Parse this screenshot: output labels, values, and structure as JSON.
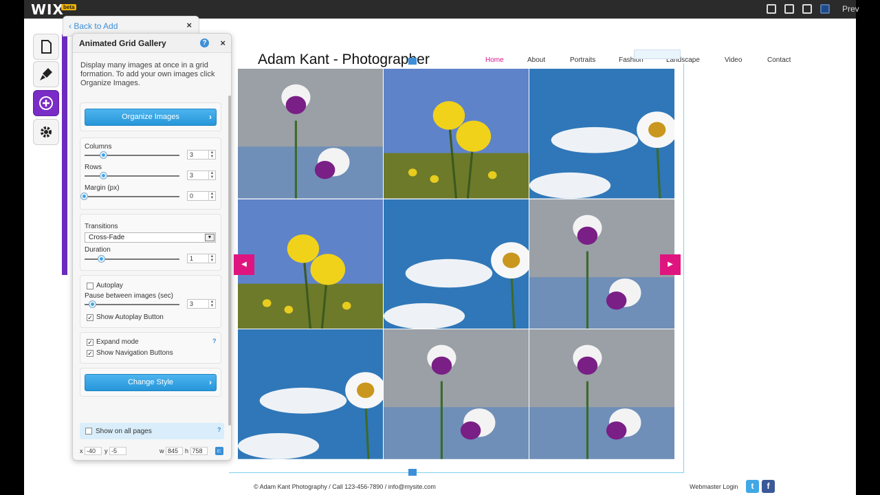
{
  "topbar": {
    "logo": "WIX",
    "beta": "beta",
    "preview": "Prev"
  },
  "back_panel": {
    "link": "Back to Add",
    "close": "×"
  },
  "panel": {
    "title": "Animated Grid Gallery",
    "help": "?",
    "close": "×",
    "description": "Display many images at once in a grid formation. To add your own images click Organize Images.",
    "organize_button": "Organize Images",
    "columns_label": "Columns",
    "columns_value": "3",
    "rows_label": "Rows",
    "rows_value": "3",
    "margin_label": "Margin (px)",
    "margin_value": "0",
    "transitions_label": "Transitions",
    "transition_value": "Cross-Fade",
    "duration_label": "Duration",
    "duration_value": "1",
    "autoplay_label": "Autoplay",
    "pause_label": "Pause between images (sec)",
    "pause_value": "3",
    "show_autoplay_label": "Show Autoplay Button",
    "expand_label": "Expand mode",
    "show_nav_label": "Show Navigation Buttons",
    "change_style_button": "Change Style",
    "show_all_pages_label": "Show on all pages",
    "x_label": "x",
    "x_value": "-40",
    "y_label": "y",
    "y_value": "-5",
    "w_label": "w",
    "w_value": "845",
    "h_label": "h",
    "h_value": "758"
  },
  "site": {
    "title": "Adam Kant - Photographer",
    "nav": [
      "Home",
      "About",
      "Portraits",
      "Fashion",
      "Landscape",
      "Video",
      "Contact"
    ],
    "footer": "© Adam Kant Photography / Call 123-456-7890 / info@mysite.com",
    "webmaster": "Webmaster Login"
  },
  "colors": {
    "accent_magenta": "#e0147f",
    "wix_purple": "#7a2cc6",
    "button_blue": "#2696d9"
  }
}
